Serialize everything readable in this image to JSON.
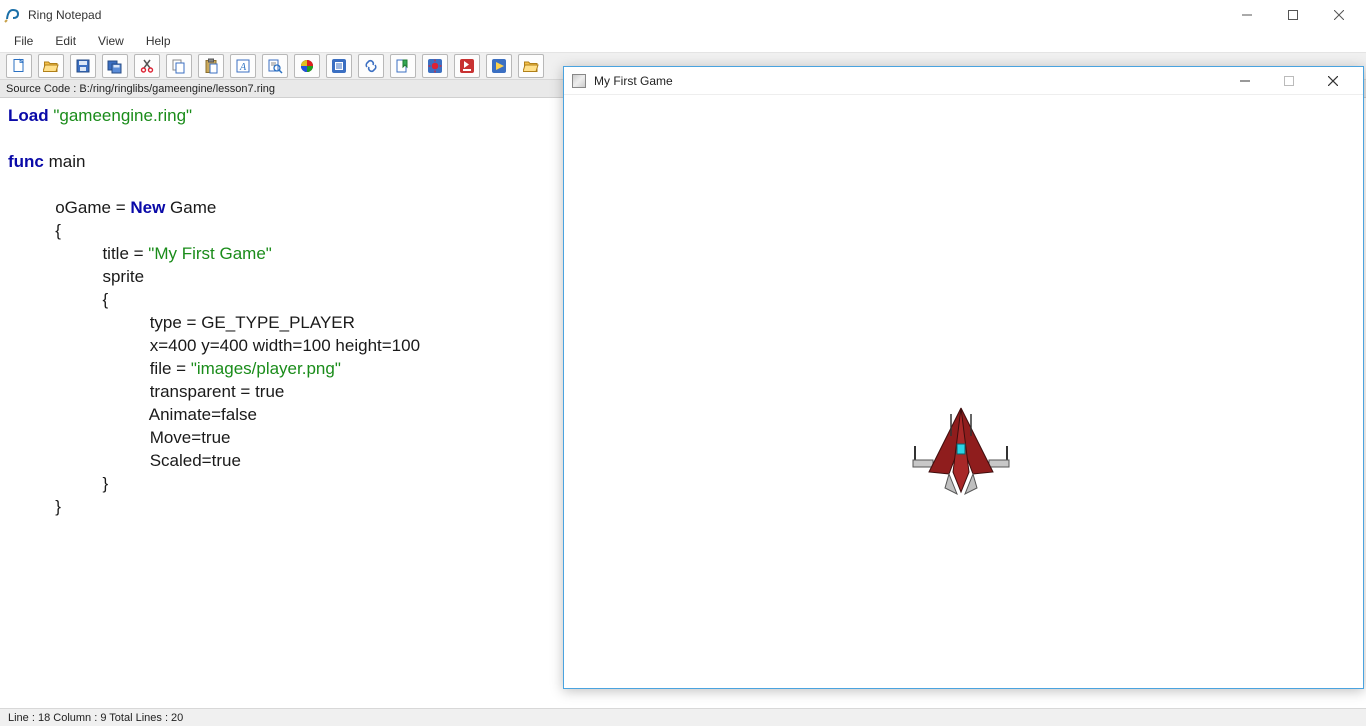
{
  "app": {
    "title": "Ring Notepad"
  },
  "menu": {
    "file": "File",
    "edit": "Edit",
    "view": "View",
    "help": "Help"
  },
  "toolbar": {
    "icons": [
      "new-file-icon",
      "open-file-icon",
      "save-icon",
      "save-copies-icon",
      "cut-icon",
      "copy-icon",
      "paste-icon",
      "font-icon",
      "find-icon",
      "color-picker-icon",
      "print-icon",
      "link-icon",
      "bookmark-icon",
      "debug-icon",
      "run-icon",
      "run-noconsole-icon",
      "open-folder-icon"
    ]
  },
  "source": {
    "label": "Source Code : B:/ring/ringlibs/gameengine/lesson7.ring"
  },
  "code": {
    "load_kw": "Load",
    "load_str": "\"gameengine.ring\"",
    "func_kw": "func",
    "main": " main",
    "ogame": "          oGame = ",
    "new_kw": "New",
    "game": " Game",
    "brace_open": "          {",
    "title_line_pre": "                    title = ",
    "title_str": "\"My First Game\"",
    "sprite": "                    sprite",
    "brace_open2": "                    {",
    "type_line": "                              type = GE_TYPE_PLAYER",
    "xy_line": "                              x=400 y=400 width=100 height=100",
    "file_pre": "                              file = ",
    "file_str": "\"images/player.png\"",
    "transparent": "                              transparent = true",
    "animate": "                              Animate=false",
    "move": "                              Move=true",
    "scaled": "                              Scaled=true",
    "brace_close2": "                    }",
    "brace_close": "          }"
  },
  "status": {
    "text": "Line : 18 Column : 9 Total Lines : 20"
  },
  "game": {
    "title": "My First Game"
  }
}
